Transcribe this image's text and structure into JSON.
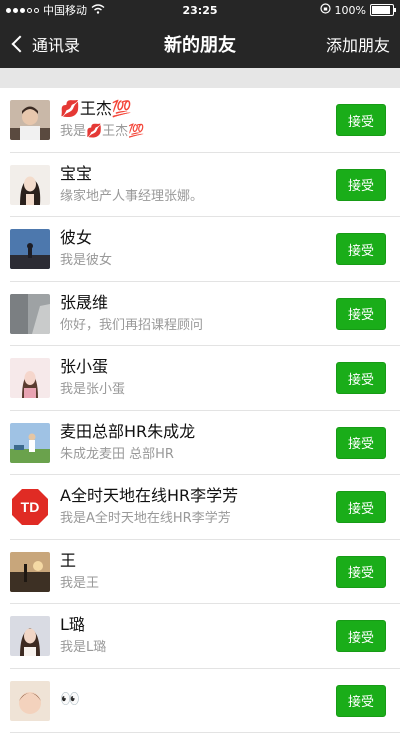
{
  "status_bar": {
    "carrier": "中国移动",
    "time": "23:25",
    "battery_text": "100%",
    "battery_level": 1.0
  },
  "nav": {
    "back_label": "通讯录",
    "title": "新的朋友",
    "action_label": "添加朋友"
  },
  "requests": [
    {
      "name": "💋王杰💯",
      "message": "我是💋王杰💯",
      "accept_label": "接受",
      "avatar": "man-portrait"
    },
    {
      "name": "宝宝",
      "message": "缘家地产人事经理张娜。",
      "accept_label": "接受",
      "avatar": "woman-portrait"
    },
    {
      "name": "彼女",
      "message": "我是彼女",
      "accept_label": "接受",
      "avatar": "blue-sky-silhouette"
    },
    {
      "name": "张晟维",
      "message": "你好，我们再招课程顾问",
      "accept_label": "接受",
      "avatar": "gray-photo"
    },
    {
      "name": "张小蛋",
      "message": "我是张小蛋",
      "accept_label": "接受",
      "avatar": "girl-portrait"
    },
    {
      "name": "麦田总部HR朱成龙",
      "message": "朱成龙麦田 总部HR",
      "accept_label": "接受",
      "avatar": "outdoor-photo"
    },
    {
      "name": "A全时天地在线HR李学芳",
      "message": "我是A全时天地在线HR李学芳",
      "accept_label": "接受",
      "avatar": "td-logo",
      "logo_text": "TD"
    },
    {
      "name": "王",
      "message": "我是王",
      "accept_label": "接受",
      "avatar": "sunset-photo"
    },
    {
      "name": "L璐",
      "message": "我是L璐",
      "accept_label": "接受",
      "avatar": "woman-portrait-2"
    },
    {
      "name": "👀",
      "message": "",
      "accept_label": "接受",
      "avatar": "baby-photo"
    }
  ],
  "colors": {
    "nav_bg": "#262626",
    "accept_green": "#1aad19",
    "text_primary": "#111111",
    "text_secondary": "#999999"
  }
}
